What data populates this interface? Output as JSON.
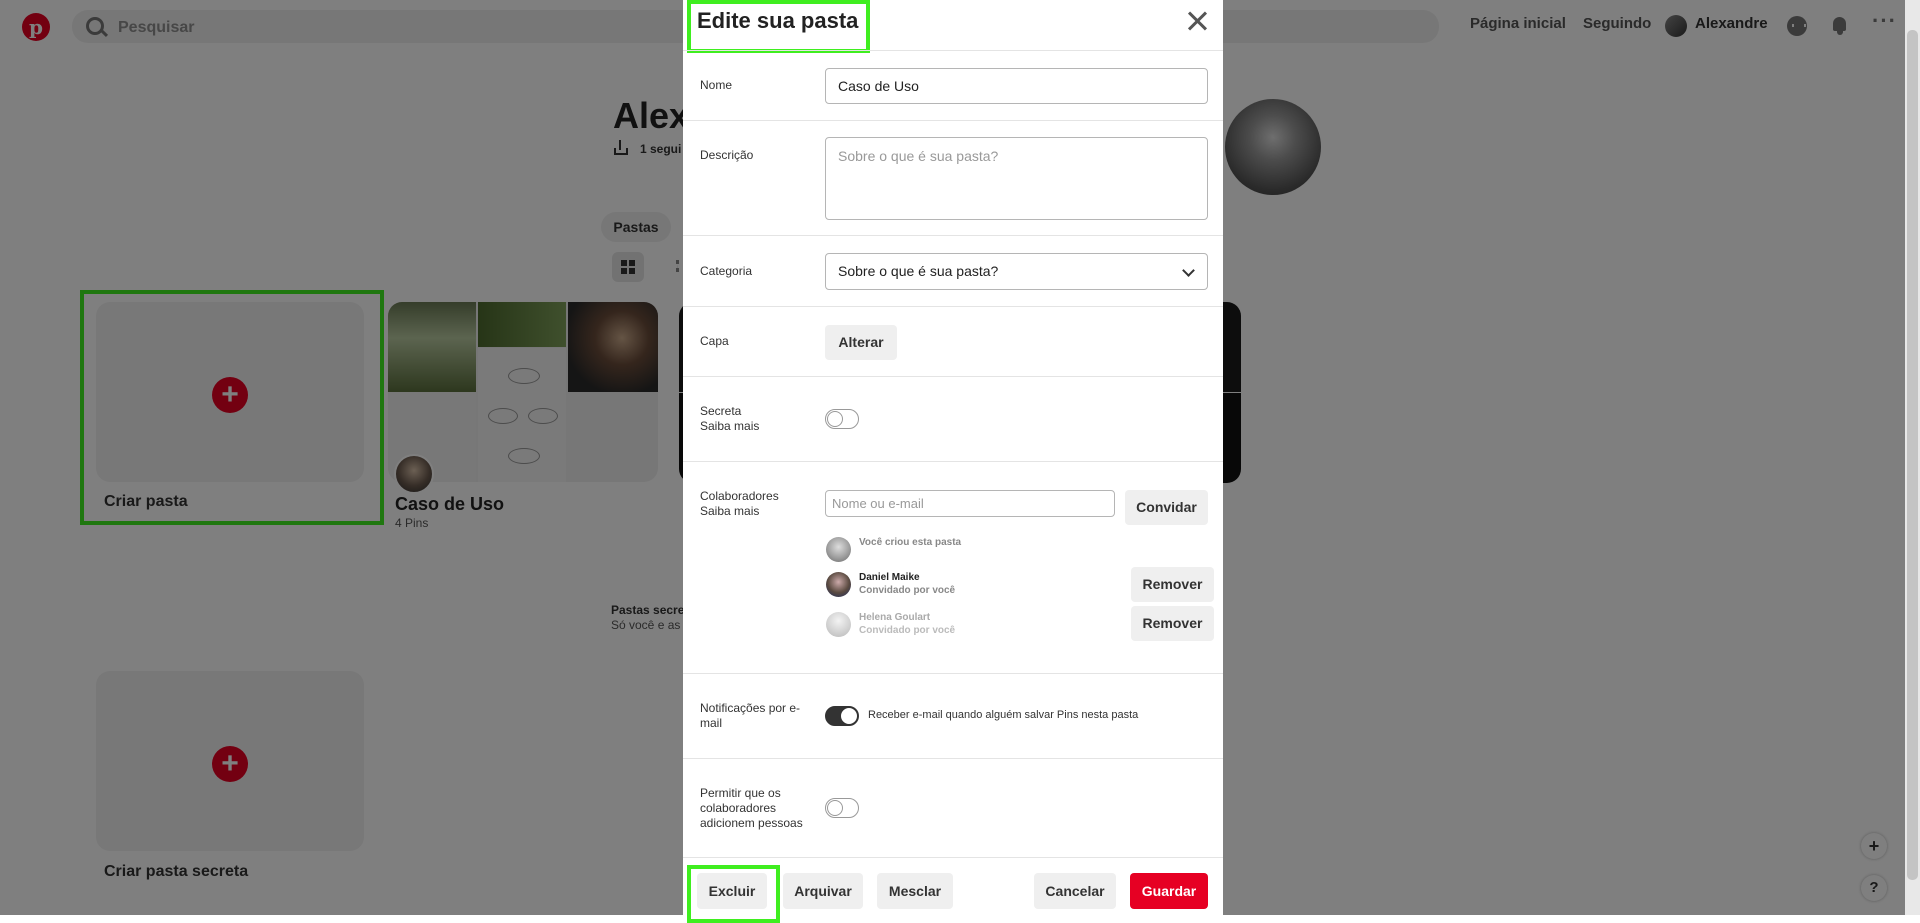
{
  "header": {
    "search_placeholder": "Pesquisar",
    "nav_home": "Página inicial",
    "nav_following": "Seguindo",
    "nav_user": "Alexandre",
    "logo_glyph": "p"
  },
  "profile": {
    "name_partial": "Alex",
    "followers_partial": "1 segui",
    "tab_boards": "Pastas"
  },
  "boards": {
    "create_board": "Criar pasta",
    "board_title": "Caso de Uso",
    "board_pins": "4 Pins",
    "secret_heading": "Pastas secre",
    "secret_desc": "Só você e as p",
    "create_secret": "Criar pasta secreta"
  },
  "modal": {
    "title": "Edite sua pasta",
    "name_label": "Nome",
    "name_value": "Caso de Uso",
    "description_label": "Descrição",
    "description_placeholder": "Sobre o que é sua pasta?",
    "category_label": "Categoria",
    "category_value": "Sobre o que é sua pasta?",
    "cover_label": "Capa",
    "cover_button": "Alterar",
    "secret_label": "Secreta",
    "secret_learn_more": "Saiba mais",
    "secret_on": false,
    "collaborators_label": "Colaboradores",
    "collaborators_learn_more": "Saiba mais",
    "collab_placeholder": "Nome ou e-mail",
    "invite_button": "Convidar",
    "collaborators": [
      {
        "name": "Você criou esta pasta",
        "subtitle": ""
      },
      {
        "name": "Daniel Maike",
        "subtitle": "Convidado por você",
        "action": "Remover"
      },
      {
        "name": "Helena Goulart",
        "subtitle": "Convidado por você",
        "action": "Remover"
      }
    ],
    "notifications_label": "Notificações por e-mail",
    "notifications_desc": "Receber e-mail quando alguém salvar Pins nesta pasta",
    "notifications_on": true,
    "permission_label": "Permitir que os colaboradores adicionem pessoas",
    "permission_on": false,
    "delete_button": "Excluir",
    "archive_button": "Arquivar",
    "merge_button": "Mesclar",
    "cancel_button": "Cancelar",
    "save_button": "Guardar"
  },
  "fab": {
    "plus": "+",
    "help": "?"
  },
  "colors": {
    "brand": "#e60023",
    "highlight": "#3fee1f",
    "overlay": "rgba(0,0,0,0.5)"
  }
}
